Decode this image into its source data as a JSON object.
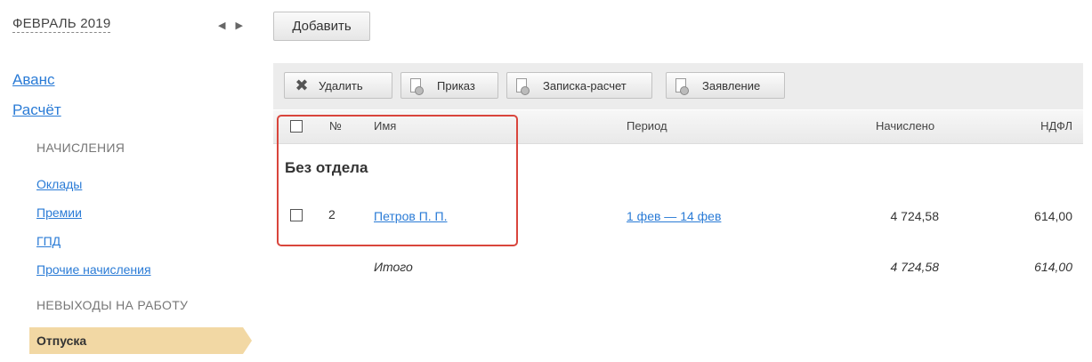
{
  "sidebar": {
    "month": "ФЕВРАЛЬ 2019",
    "prev_arrow": "◀",
    "next_arrow": "▶",
    "links": {
      "avans": "Аванс",
      "raschet": "Расчёт"
    },
    "sections": {
      "accruals": "НАЧИСЛЕНИЯ",
      "absences": "НЕВЫХОДЫ НА РАБОТУ"
    },
    "accrual_items": [
      "Оклады",
      "Премии",
      "ГПД",
      "Прочие начисления"
    ],
    "active_item": "Отпуска"
  },
  "actions": {
    "add_label": "Добавить"
  },
  "toolbar": {
    "delete_label": "Удалить",
    "order_label": "Приказ",
    "note_label": "Записка-расчет",
    "statement_label": "Заявление"
  },
  "table": {
    "columns": {
      "num": "№",
      "name": "Имя",
      "period": "Период",
      "accrued": "Начислено",
      "ndfl": "НДФЛ"
    },
    "group_title": "Без отдела",
    "rows": [
      {
        "num": "2",
        "name": "Петров П. П.",
        "period": "1 фев — 14 фев",
        "accrued": "4 724,58",
        "ndfl": "614,00"
      }
    ],
    "total": {
      "label": "Итого",
      "accrued": "4 724,58",
      "ndfl": "614,00"
    }
  },
  "colors": {
    "link": "#2a7bd6",
    "active_bg": "#f2d8a4",
    "highlight": "#d9453c"
  }
}
